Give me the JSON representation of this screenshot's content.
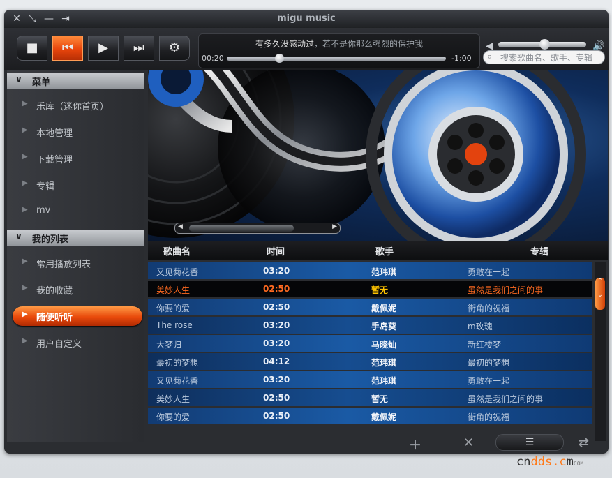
{
  "window": {
    "title": "migu music",
    "buttons": [
      "✕",
      "⤡",
      "—",
      "⇥"
    ]
  },
  "player": {
    "now_playing": "有多久没感动过",
    "now_playing_sub": "，若不是你那么强烈的保护我",
    "elapsed": "00:20",
    "remaining": "-1:00",
    "progress": 0.24,
    "volume": 0.52
  },
  "search": {
    "placeholder": "搜索歌曲名、歌手、专辑"
  },
  "sidebar": {
    "section1": "菜单",
    "menu": [
      "乐库（迷你首页）",
      "本地管理",
      "下载管理",
      "专辑",
      "mv"
    ],
    "section2": "我的列表",
    "lists": [
      "常用播放列表",
      "我的收藏",
      "随便听听",
      "用户自定义"
    ],
    "selected_list": 2
  },
  "table": {
    "headers": [
      "歌曲名",
      "时间",
      "歌手",
      "专辑"
    ],
    "rows": [
      {
        "title": "又见菊花香",
        "time": "03:20",
        "artist": "范玮琪",
        "album": "勇敢在一起"
      },
      {
        "title": "美妙人生",
        "time": "02:50",
        "artist": "暂无",
        "album": "虽然是我们之间的事"
      },
      {
        "title": "你要的爱",
        "time": "02:50",
        "artist": "戴佩妮",
        "album": "街角的祝福"
      },
      {
        "title": "The rose",
        "time": "03:20",
        "artist": "手岛葵",
        "album": "m玫瑰"
      },
      {
        "title": "大梦归",
        "time": "03:20",
        "artist": "马晓灿",
        "album": "新红楼梦"
      },
      {
        "title": "最初的梦想",
        "time": "04:12",
        "artist": "范玮琪",
        "album": "最初的梦想"
      },
      {
        "title": "又见菊花香",
        "time": "03:20",
        "artist": "范玮琪",
        "album": "勇敢在一起"
      },
      {
        "title": "美妙人生",
        "time": "02:50",
        "artist": "暂无",
        "album": "虽然是我们之间的事"
      },
      {
        "title": "你要的爱",
        "time": "02:50",
        "artist": "戴佩妮",
        "album": "街角的祝福"
      }
    ],
    "playing_row": 1
  },
  "footer": {
    "icons": [
      "add-icon",
      "delete-icon",
      "list-icon",
      "repeat-icon"
    ]
  },
  "watermark": {
    "text_a": "cn",
    "text_b": "dds.c",
    "text_c": "m",
    "sup": "COM"
  },
  "colors": {
    "accent": "#e8490b",
    "table_blue": "#1a5aa5"
  }
}
